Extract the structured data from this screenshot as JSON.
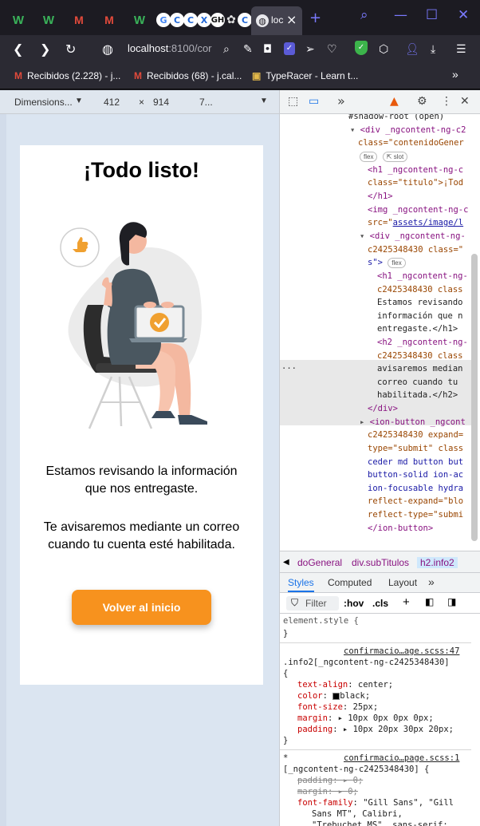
{
  "tabs": {
    "icons": [
      "W",
      "W",
      "M",
      "M",
      "W",
      "G",
      "C",
      "C",
      "X",
      "GH",
      "OA",
      "C"
    ],
    "active_title": "loc",
    "close": "×",
    "new_tab": "+"
  },
  "nav": {
    "url_host": "localhost",
    "url_rest": ":8100/cor"
  },
  "bookmarks": [
    {
      "label": "Recibidos (2.228) - j..."
    },
    {
      "label": "Recibidos (68) - j.cal..."
    },
    {
      "label": "TypeRacer - Learn t..."
    }
  ],
  "device_toolbar": {
    "preset": "Dimensions...",
    "width": "412",
    "times": "×",
    "height": "914",
    "zoom": "7..."
  },
  "page": {
    "title": "¡Todo listo!",
    "info1": "Estamos revisando la información que nos entregaste.",
    "info2": "Te avisaremos mediante un correo cuando tu cuenta esté habilitada.",
    "button": "Volver al inicio"
  },
  "devtools": {
    "breadcrumbs": [
      "doGeneral",
      "div.subTitulos",
      "h2.info2"
    ],
    "style_tabs": [
      "Styles",
      "Computed",
      "Layout"
    ],
    "filter": "Filter",
    "hov": ":hov",
    "cls": ".cls",
    "dom": {
      "l1": "#shadow-root (open)",
      "l2a": "<div _ngcontent-ng-c2",
      "l2b": "class=\"contenidoGener",
      "pill_flex": "flex",
      "pill_slot": "slot",
      "l3a": "<h1 _ngcontent-ng-c",
      "l3b": "class=\"titulo\">¡Tod",
      "l3c": "</h1>",
      "l4a": "<img _ngcontent-ng-c",
      "l4b": "src=\"",
      "l4c": "assets/image/l",
      "l5a": "<div _ngcontent-ng-",
      "l5b": "c2425348430 class=\"",
      "l5c": "s\">",
      "l6a": "<h1 _ngcontent-ng-",
      "l6b": "c2425348430 class",
      "l6c": "Estamos revisando",
      "l6d": "información que n",
      "l6e": "entregaste.</h1>",
      "l7a": "<h2 _ngcontent-ng-",
      "l7b": "c2425348430 class",
      "l7c": "avisaremos median",
      "l7d": "correo cuando tu",
      "l7e": "habilitada.</h2>",
      "l8": "</div>",
      "l9a": "<ion-button _ngcont",
      "l9b": "c2425348430 expand=",
      "l9c": "type=\"submit\" class",
      "l9d": "ceder md button but",
      "l9e": "button-solid ion-ac",
      "l9f": "ion-focusable hydra",
      "l9g": "reflect-expand=\"blo",
      "l9h": "reflect-type=\"submi",
      "l9i": "</ion-button>",
      "ellipsis": "..."
    },
    "styles": {
      "element_style": "element.style {",
      "close_brace": "}",
      "src1": "confirmacio…age.scss:47",
      "sel1": ".info2[_ngcontent-ng-c2425348430]",
      "open_brace": "{",
      "p1": "text-align",
      "v1": "center;",
      "p2": "color",
      "v2": "black;",
      "p3": "font-size",
      "v3": "25px;",
      "p4": "margin",
      "v4": "10px 0px 0px 0px;",
      "p5": "padding",
      "v5": "10px 20px 30px 20px;",
      "star": "*",
      "src2": "confirmacio…page.scss:1",
      "sel2": "[_ngcontent-ng-c2425348430] {",
      "p6": "padding",
      "v6": "0;",
      "p7": "margin",
      "v7": "0;",
      "p8": "font-family",
      "v8": "\"Gill Sans\", \"Gill",
      "v8b": "Sans MT\", Calibri,",
      "v8c": "\"Trebuchet MS\", sans-serif;"
    }
  },
  "colors": {
    "accent_button": "#f7921e",
    "viewport_bg": "#dbe5f1"
  }
}
